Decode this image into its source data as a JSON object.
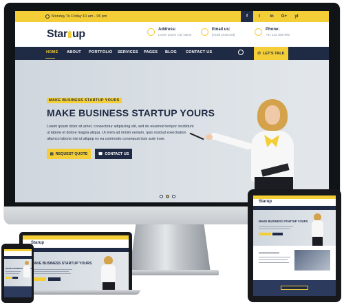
{
  "site": {
    "hours": "Monday To Friday  10 am - 06 pm",
    "logo": {
      "left": "Star",
      "right": "up"
    },
    "social": [
      "f",
      "t",
      "in",
      "G+",
      "yt"
    ],
    "address": {
      "title": "Address:",
      "value": "Lorem Ipsum City Name"
    },
    "email": {
      "title": "Email us:",
      "value": "[email protected]"
    },
    "phone": {
      "title": "Phone:",
      "value": "+91 123 4567890"
    },
    "nav": [
      "HOME",
      "ABOUT",
      "PORTFOLIO",
      "SERVICES",
      "PAGES",
      "BLOG",
      "CONTACT US"
    ],
    "cta": "LET'S TALK",
    "hero": {
      "kicker": "MAKE BUSINESS STARTUP YOURS",
      "title": "MAKE BUSINESS STARTUP YOURS",
      "text": "Lorem ipsum dolor sit amet, consectetur adipiscing elit, sed do eiusmod tempor incididunt ut labore et dolore magna aliqua. Ut enim ad minim veniam, quis nostrud exercitation ullamco laboris nisi ut aliquip ex ea commodo consequat duis aute irure.",
      "btn_quote": "REQUEST QUOTE",
      "btn_contact": "CONTACT US"
    },
    "slider_dots": 3,
    "slider_active": 2
  },
  "colors": {
    "yellow": "#f4ce36",
    "navy": "#1f2a44",
    "hero_bg": "#d9dfe5"
  },
  "icons": [
    "clock-icon",
    "map-pin-icon",
    "mail-icon",
    "phone-icon",
    "search-icon",
    "chat-icon",
    "rocket-icon"
  ]
}
